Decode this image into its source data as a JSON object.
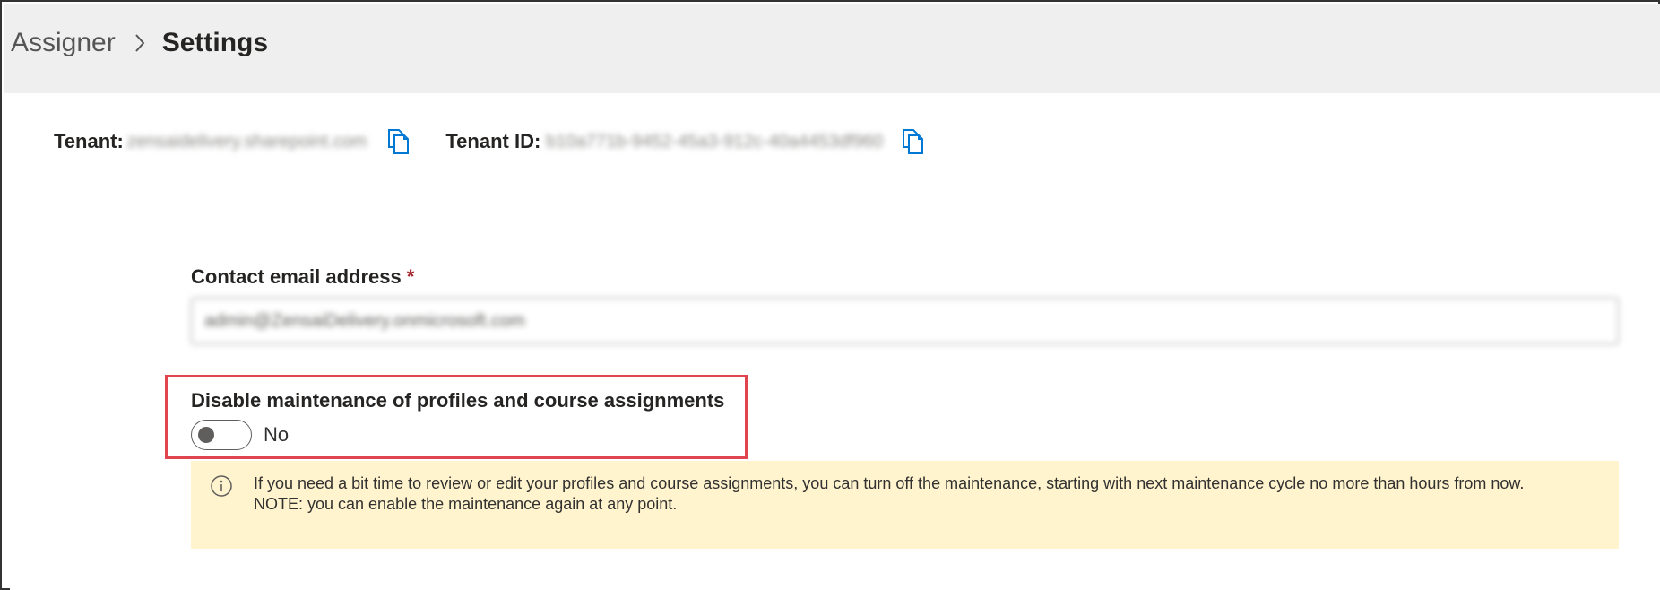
{
  "breadcrumb": {
    "parent": "Assigner",
    "current": "Settings"
  },
  "tenant": {
    "label": "Tenant:",
    "value": "zensaidelivery.sharepoint.com",
    "id_label": "Tenant ID:",
    "id_value": "b10a771b-9452-45a3-912c-40a4453df960"
  },
  "contact_email": {
    "label": "Contact email address",
    "required_mark": "*",
    "value": "admin@ZensaiDelivery.onmicrosoft.com"
  },
  "maintenance": {
    "label": "Disable maintenance of profiles and course assignments",
    "state_text": "No",
    "enabled": false
  },
  "notice": {
    "line1": "If you need a bit time to review or edit your profiles and course assignments, you can turn off the maintenance, starting with next maintenance cycle no more than hours from now.",
    "line2": "NOTE: you can enable the maintenance again at any point."
  },
  "colors": {
    "accent": "#0078d4",
    "header_bg": "#efefef",
    "notice_bg": "#fff4ce",
    "highlight": "#e0454f",
    "required": "#a4262c"
  },
  "icons": {
    "breadcrumb_separator": "chevron-right-icon",
    "copy": "copy-icon",
    "info": "info-icon"
  }
}
